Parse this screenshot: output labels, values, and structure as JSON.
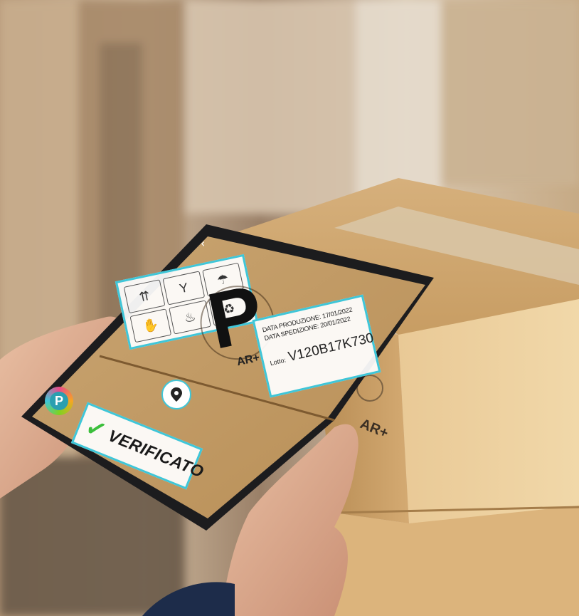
{
  "scene": {
    "description_free": true
  },
  "ar_overlay": {
    "info_panel": {
      "production_label": "DATA PRODUZIONE:",
      "production_date": "17/01/2022",
      "shipping_label": "DATA SPEDIZIONE:",
      "shipping_date": "20/01/2022",
      "lot_label": "Lotto:",
      "lot_code": "V120B17K730"
    },
    "verification": {
      "status": "VERIFICATO"
    },
    "icons": [
      "fragile-icon",
      "this-way-up-icon",
      "keep-dry-icon",
      "handle-with-care-icon",
      "flammable-icon",
      "recycle-icon"
    ],
    "location_pin": "location-pin-icon",
    "app_logo": "app-logo-icon"
  },
  "box_print": {
    "brand_letter": "P",
    "brand_suffix": "AR+"
  },
  "colors": {
    "accent": "#3fc6d8",
    "check": "#3cbf3c",
    "cardboard": "#c9a06b"
  }
}
